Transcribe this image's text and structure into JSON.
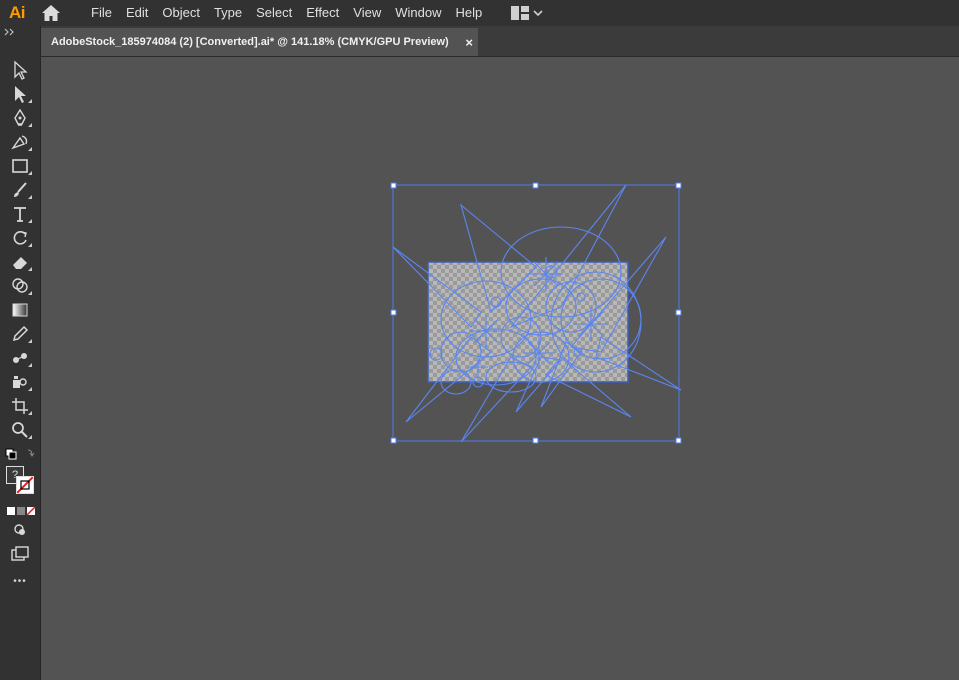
{
  "app": {
    "logo": "Ai",
    "accent_color": "#FF9A00"
  },
  "menu": {
    "items": [
      "File",
      "Edit",
      "Object",
      "Type",
      "Select",
      "Effect",
      "View",
      "Window",
      "Help"
    ]
  },
  "document": {
    "tab_title": "AdobeStock_185974084 (2) [Converted].ai* @ 141.18% (CMYK/GPU Preview)",
    "close_glyph": "×"
  },
  "toolbar": {
    "more_label": "•••",
    "tools": [
      "selection-tool-icon",
      "direct-selection-tool-icon",
      "pen-tool-icon",
      "curvature-tool-icon",
      "rectangle-tool-icon",
      "paintbrush-tool-icon",
      "type-tool-icon",
      "rotate-tool-icon",
      "eraser-tool-icon",
      "shape-builder-tool-icon",
      "gradient-tool-icon",
      "eyedropper-tool-icon",
      "blend-tool-icon",
      "symbol-sprayer-tool-icon",
      "artboard-tool-icon",
      "zoom-tool-icon"
    ],
    "fill_stroke_hint": "?"
  },
  "colors": {
    "selection": "#4F7BEA",
    "canvas": "#535353",
    "chrome": "#323232"
  }
}
